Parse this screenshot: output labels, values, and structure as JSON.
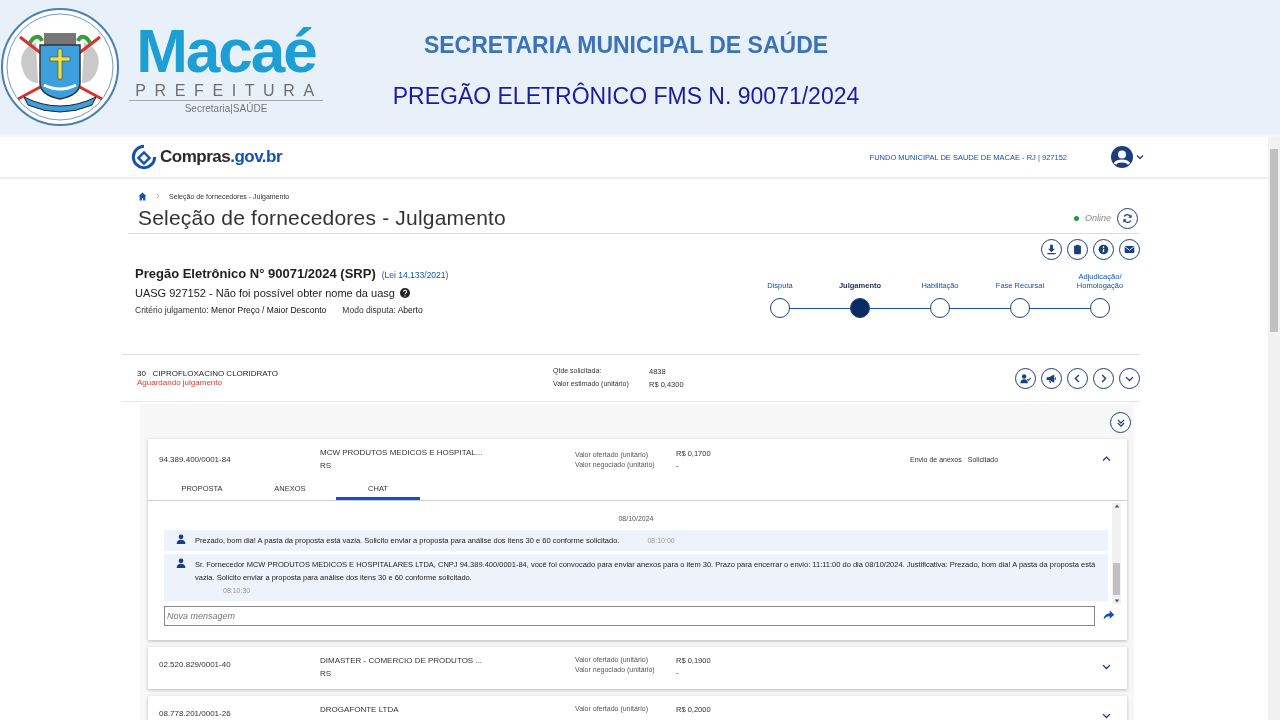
{
  "banner": {
    "logo": {
      "name": "Macaé",
      "subtitle": "PREFEITURA",
      "department": "Secretaria|SAÚDE"
    },
    "heading": "SECRETARIA MUNICIPAL DE SAÚDE",
    "subheading": "PREGÃO ELETRÔNICO FMS N. 90071/2024"
  },
  "header": {
    "brand": "Compras",
    "brand_domain": ".gov.br",
    "organization": "FUNDO MUNICIPAL DE SAUDE DE MACAE - RJ | 927152"
  },
  "breadcrumb": [
    "Seleção de fornecedores - Julgamento"
  ],
  "page_title": "Seleção de fornecedores - Julgamento",
  "status": {
    "label": "Online",
    "online": true
  },
  "toolbar": [
    {
      "kind": "download"
    },
    {
      "kind": "clipboard"
    },
    {
      "kind": "info"
    },
    {
      "kind": "mail"
    }
  ],
  "procurement": {
    "title": "Pregão Eletrônico N° 90071/2024 (SRP)",
    "law": "(Lei 14.133/2021)",
    "uasg": "UASG 927152 - Não foi possível obter nome da uasg",
    "criteria_label": "Critério julgamento:",
    "criteria_value": "Menor Preço / Maior Desconto",
    "mode_label": "Modo disputa:",
    "mode_value": "Aberto"
  },
  "steps": [
    {
      "label": "Disputa",
      "selected": false
    },
    {
      "label": "Julgamento",
      "selected": true
    },
    {
      "label": "Habilitação",
      "selected": false
    },
    {
      "label": "Fase Recursal",
      "selected": false
    },
    {
      "label": "Adjudicação/ Homologação",
      "selected": false
    }
  ],
  "item": {
    "number": "30",
    "name": "CIPROFLOXACINO CLORIDRATO",
    "status": "Aguardando julgamento",
    "fields": [
      {
        "label": "Qtde solicitada:",
        "value": "4838"
      },
      {
        "label": "Valor estimado (unitário)",
        "value": "R$ 0,4300"
      }
    ],
    "actions": [
      {
        "kind": "user-check"
      },
      {
        "kind": "megaphone"
      },
      {
        "kind": "prev"
      },
      {
        "kind": "next"
      },
      {
        "kind": "expand"
      }
    ]
  },
  "suppliers": [
    {
      "cnpj": "94.389.400/0001-84",
      "name": "MCW PRODUTOS MEDICOS E HOSPITAL...",
      "state": "RS",
      "offered_label": "Valor ofertado (unitário)",
      "offered_value": "R$ 0,1700",
      "negotiated_label": "Valor negociado (unitário)",
      "negotiated_value": "-",
      "attachments_label": "Envio de anexos",
      "attachments_value": "Solicitado",
      "expanded": true,
      "tabs": [
        {
          "label": "PROPOSTA",
          "selected": false
        },
        {
          "label": "ANEXOS",
          "selected": false
        },
        {
          "label": "CHAT",
          "selected": true
        }
      ],
      "chat": {
        "date": "08/10/2024",
        "messages": [
          {
            "text": "Prezado, bom dia! A pasta da proposta está vazia. Solicito enviar a proposta para análise dos itens 30 e 60 conforme solicitado.",
            "time": "08:10:00"
          },
          {
            "text": "Sr. Fornecedor MCW PRODUTOS MEDICOS E HOSPITALARES LTDA, CNPJ 94.389.400/0001-84, você foi convocado para enviar anexos para o item 30. Prazo para encerrar o envio: 11:11:00 do dia 08/10/2024. Justificativa: Prezado, bom dia! A pasta da proposta está vazia. Solicito enviar a proposta para análise dos itens 30 e 60 conforme solicitado.",
            "time": "08:10:30"
          }
        ],
        "placeholder": "Nova mensagem"
      }
    },
    {
      "cnpj": "02.520.829/0001-40",
      "name": "DIMASTER - COMERCIO DE PRODUTOS ...",
      "state": "RS",
      "offered_label": "Valor ofertado (unitário)",
      "offered_value": "R$ 0,1900",
      "negotiated_label": "Valor negociado (unitário)",
      "negotiated_value": "-",
      "expanded": false
    },
    {
      "cnpj": "08.778.201/0001-26",
      "name": "DROGAFONTE LTDA",
      "offered_label": "Valor ofertado (unitário)",
      "offered_value": "R$ 0,2000",
      "expanded": false
    }
  ]
}
